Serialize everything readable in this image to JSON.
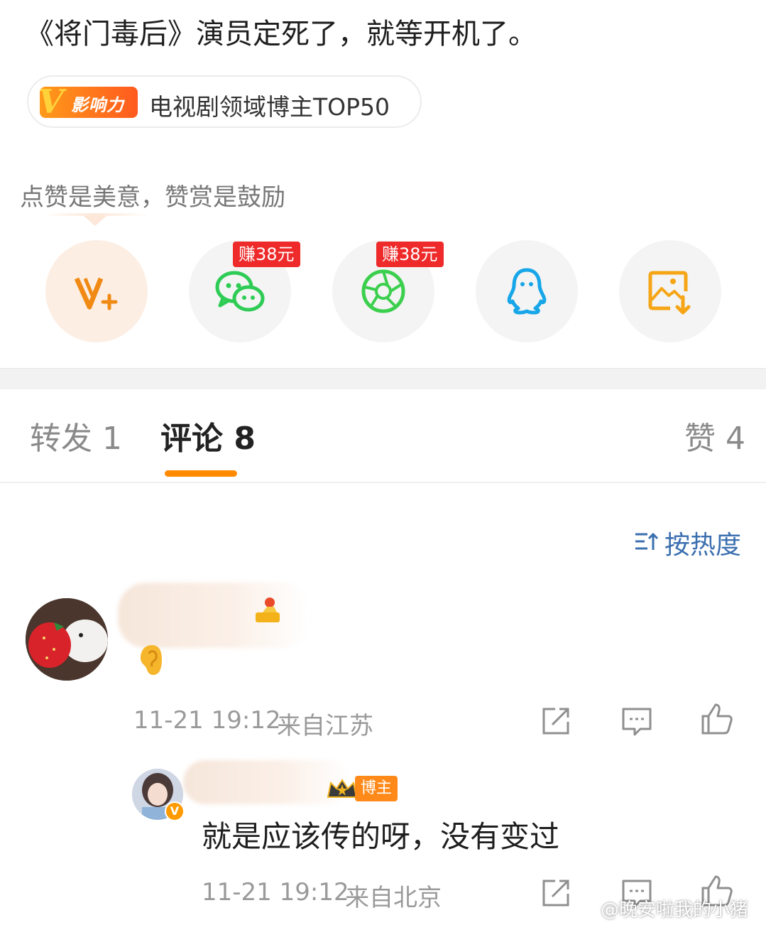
{
  "post": {
    "text": "《将门毒后》演员定死了，就等开机了。",
    "badge_text": "影响力",
    "badge_label": "电视剧领域博主TOP50"
  },
  "reward": {
    "tip": "点赞是美意，赞赏是鼓励"
  },
  "share": {
    "earn_tag_1": "赚38元",
    "earn_tag_2": "赚38元"
  },
  "tabs": {
    "repost": "转发 1",
    "comments": "评论 8",
    "likes": "赞 4"
  },
  "sort": {
    "label": "按热度"
  },
  "comment": {
    "time": "11-21 19:12",
    "location": "来自江苏"
  },
  "reply": {
    "tag": "博主",
    "verified_mark": "V",
    "text": "就是应该传的呀，没有变过",
    "time": "11-21 19:12",
    "location": "来自北京"
  },
  "watermark": {
    "text": "@晚安啦我的小猪"
  },
  "colors": {
    "accent_orange": "#ff8a00",
    "sort_blue": "#3b6fb0",
    "earn_red": "#ee2a2a",
    "wechat_green": "#2ecc55",
    "qq_blue": "#17a6e8"
  }
}
